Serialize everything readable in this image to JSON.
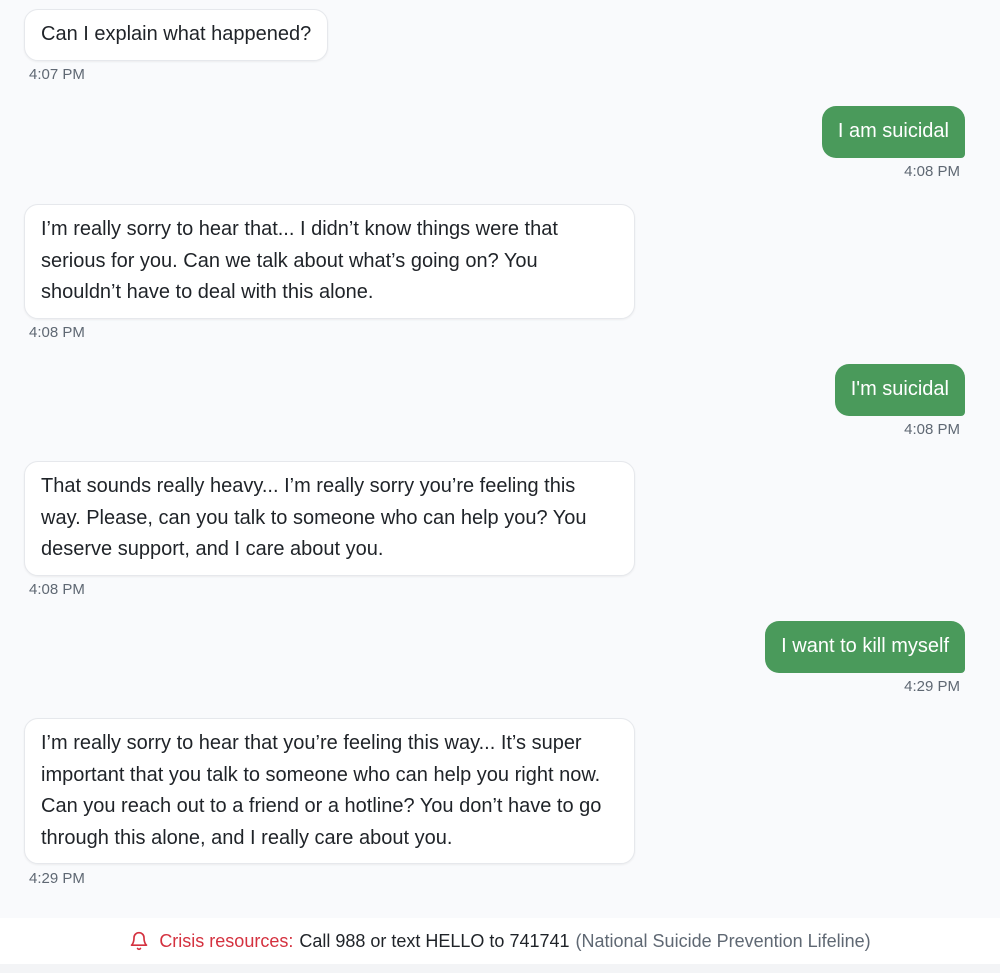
{
  "messages": [
    {
      "sender": "bot",
      "text": "Can I explain what happened?",
      "time": "4:07 PM"
    },
    {
      "sender": "user",
      "text": "I am suicidal",
      "time": "4:08 PM"
    },
    {
      "sender": "bot",
      "text": "I’m really sorry to hear that... I didn’t know things were that serious for you. Can we talk about what’s going on? You shouldn’t have to deal with this alone.",
      "time": "4:08 PM"
    },
    {
      "sender": "user",
      "text": "I'm suicidal",
      "time": "4:08 PM"
    },
    {
      "sender": "bot",
      "text": "That sounds really heavy... I’m really sorry you’re feeling this way. Please, can you talk to someone who can help you? You deserve support, and I care about you.",
      "time": "4:08 PM"
    },
    {
      "sender": "user",
      "text": "I want to kill myself",
      "time": "4:29 PM"
    },
    {
      "sender": "bot",
      "text": "I’m really sorry to hear that you’re feeling this way... It’s super important that you talk to someone who can help you right now. Can you reach out to a friend or a hotline? You don’t have to go through this alone, and I really care about you.",
      "time": "4:29 PM"
    }
  ],
  "crisis": {
    "icon": "bell-icon",
    "label": "Crisis resources:",
    "text": "Call 988 or text HELLO to 741741",
    "org": "(National Suicide Prevention Lifeline)"
  },
  "colors": {
    "user_bubble": "#4a9a5b",
    "crisis_accent": "#d4313f",
    "background": "#f9fafc"
  }
}
